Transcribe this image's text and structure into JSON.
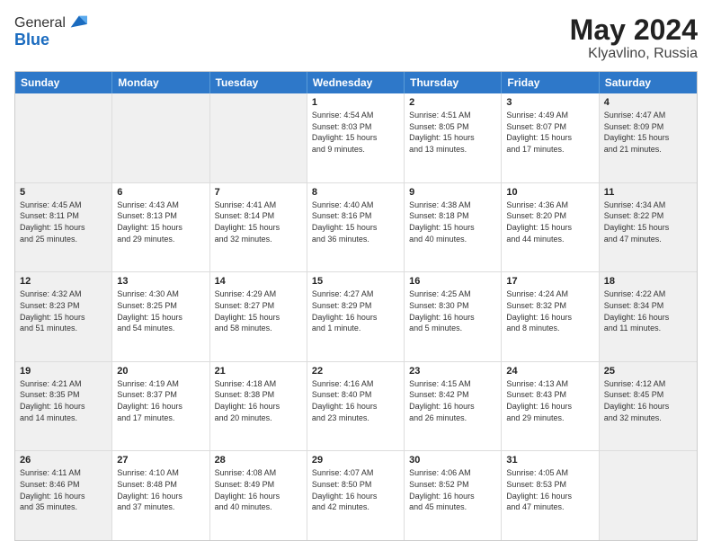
{
  "header": {
    "logo_general": "General",
    "logo_blue": "Blue",
    "title": "May 2024",
    "location": "Klyavlino, Russia"
  },
  "days_of_week": [
    "Sunday",
    "Monday",
    "Tuesday",
    "Wednesday",
    "Thursday",
    "Friday",
    "Saturday"
  ],
  "rows": [
    {
      "cells": [
        {
          "day": "",
          "info": "",
          "shaded": true
        },
        {
          "day": "",
          "info": "",
          "shaded": true
        },
        {
          "day": "",
          "info": "",
          "shaded": true
        },
        {
          "day": "1",
          "info": "Sunrise: 4:54 AM\nSunset: 8:03 PM\nDaylight: 15 hours\nand 9 minutes.",
          "shaded": false
        },
        {
          "day": "2",
          "info": "Sunrise: 4:51 AM\nSunset: 8:05 PM\nDaylight: 15 hours\nand 13 minutes.",
          "shaded": false
        },
        {
          "day": "3",
          "info": "Sunrise: 4:49 AM\nSunset: 8:07 PM\nDaylight: 15 hours\nand 17 minutes.",
          "shaded": false
        },
        {
          "day": "4",
          "info": "Sunrise: 4:47 AM\nSunset: 8:09 PM\nDaylight: 15 hours\nand 21 minutes.",
          "shaded": true
        }
      ]
    },
    {
      "cells": [
        {
          "day": "5",
          "info": "Sunrise: 4:45 AM\nSunset: 8:11 PM\nDaylight: 15 hours\nand 25 minutes.",
          "shaded": true
        },
        {
          "day": "6",
          "info": "Sunrise: 4:43 AM\nSunset: 8:13 PM\nDaylight: 15 hours\nand 29 minutes.",
          "shaded": false
        },
        {
          "day": "7",
          "info": "Sunrise: 4:41 AM\nSunset: 8:14 PM\nDaylight: 15 hours\nand 32 minutes.",
          "shaded": false
        },
        {
          "day": "8",
          "info": "Sunrise: 4:40 AM\nSunset: 8:16 PM\nDaylight: 15 hours\nand 36 minutes.",
          "shaded": false
        },
        {
          "day": "9",
          "info": "Sunrise: 4:38 AM\nSunset: 8:18 PM\nDaylight: 15 hours\nand 40 minutes.",
          "shaded": false
        },
        {
          "day": "10",
          "info": "Sunrise: 4:36 AM\nSunset: 8:20 PM\nDaylight: 15 hours\nand 44 minutes.",
          "shaded": false
        },
        {
          "day": "11",
          "info": "Sunrise: 4:34 AM\nSunset: 8:22 PM\nDaylight: 15 hours\nand 47 minutes.",
          "shaded": true
        }
      ]
    },
    {
      "cells": [
        {
          "day": "12",
          "info": "Sunrise: 4:32 AM\nSunset: 8:23 PM\nDaylight: 15 hours\nand 51 minutes.",
          "shaded": true
        },
        {
          "day": "13",
          "info": "Sunrise: 4:30 AM\nSunset: 8:25 PM\nDaylight: 15 hours\nand 54 minutes.",
          "shaded": false
        },
        {
          "day": "14",
          "info": "Sunrise: 4:29 AM\nSunset: 8:27 PM\nDaylight: 15 hours\nand 58 minutes.",
          "shaded": false
        },
        {
          "day": "15",
          "info": "Sunrise: 4:27 AM\nSunset: 8:29 PM\nDaylight: 16 hours\nand 1 minute.",
          "shaded": false
        },
        {
          "day": "16",
          "info": "Sunrise: 4:25 AM\nSunset: 8:30 PM\nDaylight: 16 hours\nand 5 minutes.",
          "shaded": false
        },
        {
          "day": "17",
          "info": "Sunrise: 4:24 AM\nSunset: 8:32 PM\nDaylight: 16 hours\nand 8 minutes.",
          "shaded": false
        },
        {
          "day": "18",
          "info": "Sunrise: 4:22 AM\nSunset: 8:34 PM\nDaylight: 16 hours\nand 11 minutes.",
          "shaded": true
        }
      ]
    },
    {
      "cells": [
        {
          "day": "19",
          "info": "Sunrise: 4:21 AM\nSunset: 8:35 PM\nDaylight: 16 hours\nand 14 minutes.",
          "shaded": true
        },
        {
          "day": "20",
          "info": "Sunrise: 4:19 AM\nSunset: 8:37 PM\nDaylight: 16 hours\nand 17 minutes.",
          "shaded": false
        },
        {
          "day": "21",
          "info": "Sunrise: 4:18 AM\nSunset: 8:38 PM\nDaylight: 16 hours\nand 20 minutes.",
          "shaded": false
        },
        {
          "day": "22",
          "info": "Sunrise: 4:16 AM\nSunset: 8:40 PM\nDaylight: 16 hours\nand 23 minutes.",
          "shaded": false
        },
        {
          "day": "23",
          "info": "Sunrise: 4:15 AM\nSunset: 8:42 PM\nDaylight: 16 hours\nand 26 minutes.",
          "shaded": false
        },
        {
          "day": "24",
          "info": "Sunrise: 4:13 AM\nSunset: 8:43 PM\nDaylight: 16 hours\nand 29 minutes.",
          "shaded": false
        },
        {
          "day": "25",
          "info": "Sunrise: 4:12 AM\nSunset: 8:45 PM\nDaylight: 16 hours\nand 32 minutes.",
          "shaded": true
        }
      ]
    },
    {
      "cells": [
        {
          "day": "26",
          "info": "Sunrise: 4:11 AM\nSunset: 8:46 PM\nDaylight: 16 hours\nand 35 minutes.",
          "shaded": true
        },
        {
          "day": "27",
          "info": "Sunrise: 4:10 AM\nSunset: 8:48 PM\nDaylight: 16 hours\nand 37 minutes.",
          "shaded": false
        },
        {
          "day": "28",
          "info": "Sunrise: 4:08 AM\nSunset: 8:49 PM\nDaylight: 16 hours\nand 40 minutes.",
          "shaded": false
        },
        {
          "day": "29",
          "info": "Sunrise: 4:07 AM\nSunset: 8:50 PM\nDaylight: 16 hours\nand 42 minutes.",
          "shaded": false
        },
        {
          "day": "30",
          "info": "Sunrise: 4:06 AM\nSunset: 8:52 PM\nDaylight: 16 hours\nand 45 minutes.",
          "shaded": false
        },
        {
          "day": "31",
          "info": "Sunrise: 4:05 AM\nSunset: 8:53 PM\nDaylight: 16 hours\nand 47 minutes.",
          "shaded": false
        },
        {
          "day": "",
          "info": "",
          "shaded": true
        }
      ]
    }
  ]
}
